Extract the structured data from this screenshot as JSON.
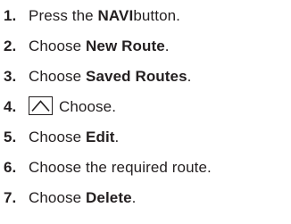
{
  "steps": [
    {
      "num": "1.",
      "pre": "Press the ",
      "bold": "NAVI",
      "post": " button."
    },
    {
      "num": "2.",
      "pre": "Choose ",
      "bold": "New Route",
      "post": "."
    },
    {
      "num": "3.",
      "pre": "Choose ",
      "bold": "Saved Routes",
      "post": "."
    },
    {
      "num": "4.",
      "icon": "chevron-up-icon",
      "text": "Choose."
    },
    {
      "num": "5.",
      "pre": "Choose ",
      "bold": "Edit",
      "post": "."
    },
    {
      "num": "6.",
      "text": "Choose the required route."
    },
    {
      "num": "7.",
      "pre": "Choose ",
      "bold": "Delete",
      "post": "."
    }
  ]
}
